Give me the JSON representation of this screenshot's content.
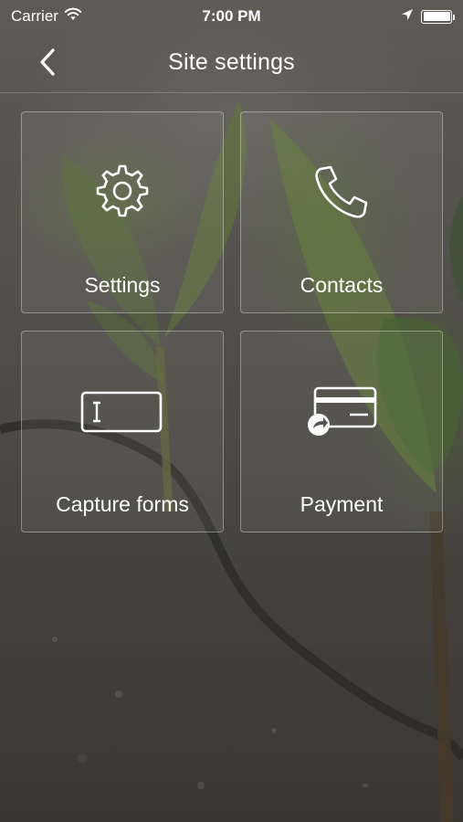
{
  "status_bar": {
    "carrier": "Carrier",
    "time": "7:00 PM",
    "battery_level": 1.0
  },
  "nav": {
    "title": "Site settings",
    "back_icon": "chevron-left-icon"
  },
  "tiles": [
    {
      "label": "Settings",
      "icon": "gear-icon"
    },
    {
      "label": "Contacts",
      "icon": "phone-icon"
    },
    {
      "label": "Capture forms",
      "icon": "text-input-icon"
    },
    {
      "label": "Payment",
      "icon": "credit-card-icon"
    }
  ],
  "colors": {
    "text": "#ffffff",
    "tile_border": "rgba(255,255,255,0.35)"
  }
}
